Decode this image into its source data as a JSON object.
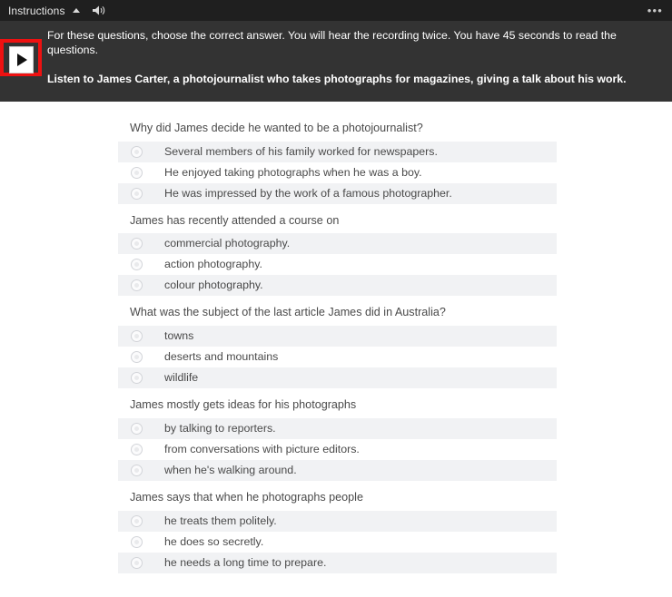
{
  "panel": {
    "title": "Instructions",
    "collapse_icon": "caret-up-icon",
    "audio_icon": "speaker-icon",
    "menu_icon": "kebab-menu-icon",
    "menu_label": "•••",
    "play_button_label": "play-icon",
    "instruction_primary": "For these questions, choose the correct answer. You will hear the recording twice. You have 45 seconds to read the questions.",
    "instruction_secondary": "Listen to James Carter, a photojournalist who takes photographs for magazines, giving a talk about his work.",
    "highlight_color": "#ee1111",
    "background_color": "#333333",
    "titlebar_color": "#1f1f1f"
  },
  "questions": [
    {
      "text": "Why did James decide he wanted to be a photojournalist?",
      "options": [
        "Several members of his family worked for newspapers.",
        "He enjoyed taking photographs when he was a boy.",
        "He was impressed by the work of a famous photographer."
      ]
    },
    {
      "text": "James has recently attended a course on",
      "options": [
        "commercial photography.",
        "action photography.",
        "colour photography."
      ]
    },
    {
      "text": "What was the subject of the last article James did in Australia?",
      "options": [
        "towns",
        "deserts and mountains",
        "wildlife"
      ]
    },
    {
      "text": "James mostly gets ideas for his photographs",
      "options": [
        "by talking to reporters.",
        "from conversations with picture editors.",
        "when he's walking around."
      ]
    },
    {
      "text": "James says that when he photographs people",
      "options": [
        "he treats them politely.",
        "he does so secretly.",
        "he needs a long time to prepare."
      ]
    }
  ]
}
